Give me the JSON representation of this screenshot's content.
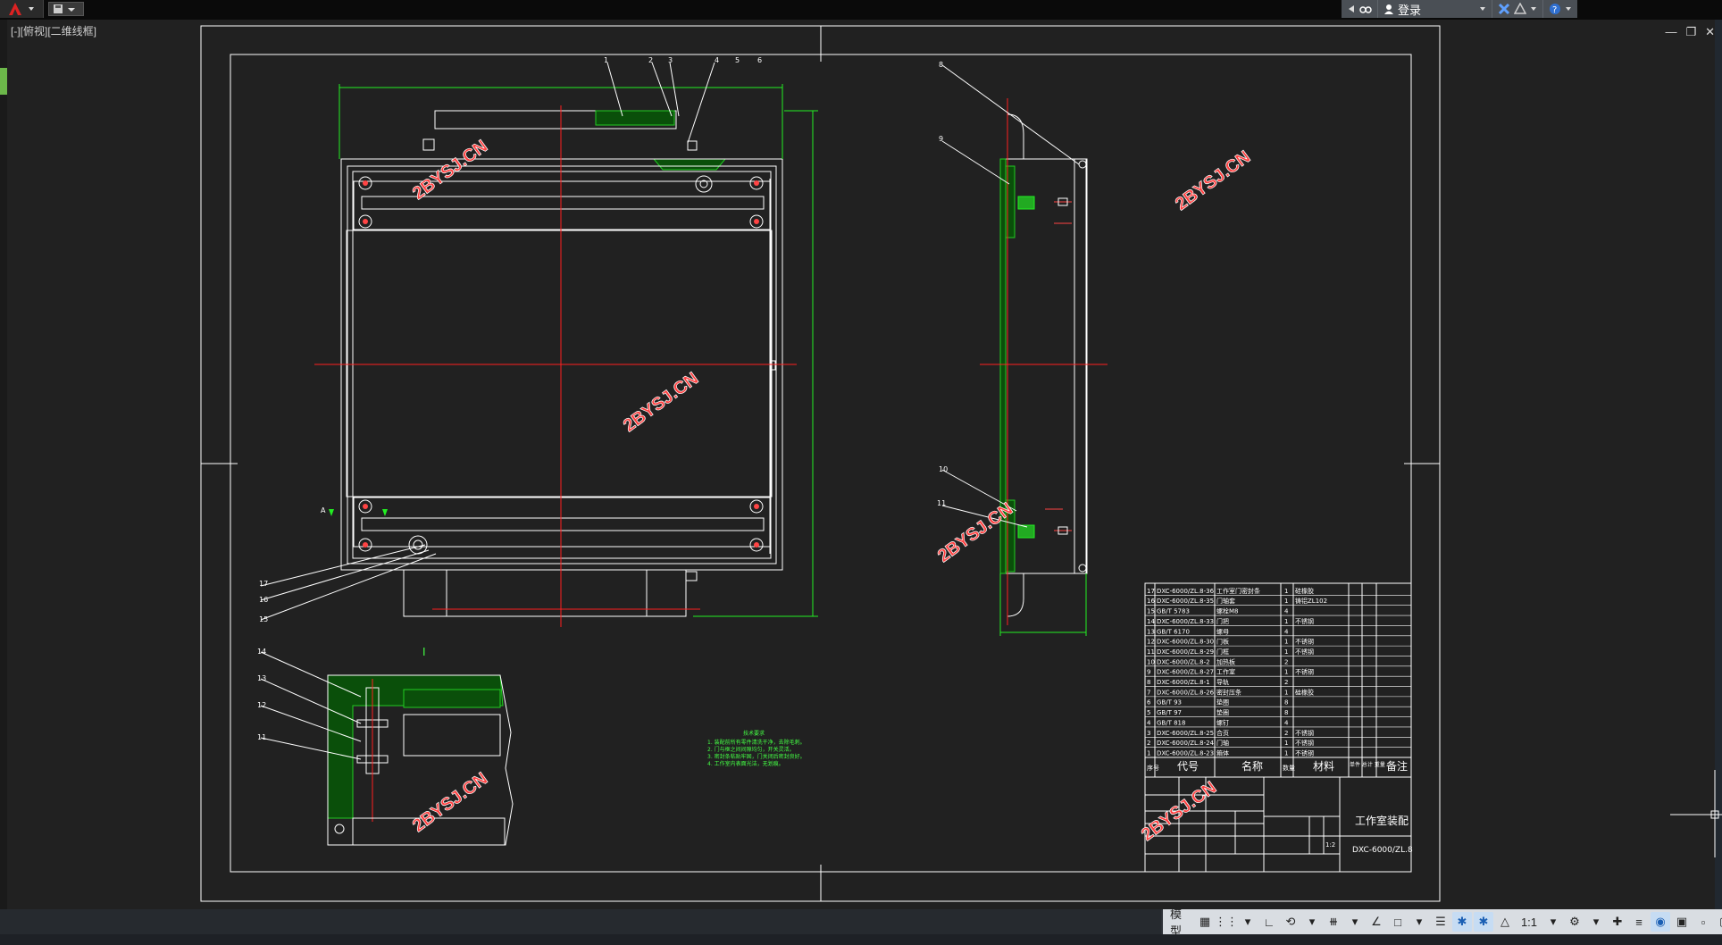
{
  "titlebar": {
    "signin_label": "登录"
  },
  "viewport": {
    "label": "[-][俯视][二维线框]"
  },
  "drawing": {
    "watermark": "2BYSJ.CN",
    "title_block": {
      "drawing_name": "工作室装配",
      "drawing_number": "DXC-6000/ZL.8",
      "scale": "1:2",
      "header_no": "序号",
      "header_code": "代号",
      "header_name": "名称",
      "header_qty": "数量",
      "header_material": "材料",
      "header_weight": "单件 总计 重量",
      "header_note": "备注"
    },
    "parts_list": [
      {
        "no": "17",
        "code": "DXC-6000/ZL.8-36",
        "name": "工作室门密封条",
        "qty": "1",
        "material": "硅橡胶"
      },
      {
        "no": "16",
        "code": "DXC-6000/ZL.8-35",
        "name": "门轴套",
        "qty": "1",
        "material": "铸铝ZL102"
      },
      {
        "no": "15",
        "code": "GB/T 5783",
        "name": "螺栓M8",
        "qty": "4",
        "material": ""
      },
      {
        "no": "14",
        "code": "DXC-6000/ZL.8-33",
        "name": "门把",
        "qty": "1",
        "material": "不锈钢"
      },
      {
        "no": "13",
        "code": "GB/T 6170",
        "name": "螺母",
        "qty": "4",
        "material": ""
      },
      {
        "no": "12",
        "code": "DXC-6000/ZL.8-30",
        "name": "门板",
        "qty": "1",
        "material": "不锈钢"
      },
      {
        "no": "11",
        "code": "DXC-6000/ZL.8-29",
        "name": "门框",
        "qty": "1",
        "material": "不锈钢"
      },
      {
        "no": "10",
        "code": "DXC-6000/ZL.8-2",
        "name": "加热板",
        "qty": "2",
        "material": ""
      },
      {
        "no": "9",
        "code": "DXC-6000/ZL.8-27",
        "name": "工作室",
        "qty": "1",
        "material": "不锈钢"
      },
      {
        "no": "8",
        "code": "DXC-6000/ZL.8-1",
        "name": "导轨",
        "qty": "2",
        "material": ""
      },
      {
        "no": "7",
        "code": "DXC-6000/ZL.8-26",
        "name": "密封压条",
        "qty": "1",
        "material": "硅橡胶"
      },
      {
        "no": "6",
        "code": "GB/T 93",
        "name": "垫圈",
        "qty": "8",
        "material": ""
      },
      {
        "no": "5",
        "code": "GB/T 97",
        "name": "垫圈",
        "qty": "8",
        "material": ""
      },
      {
        "no": "4",
        "code": "GB/T 818",
        "name": "螺钉",
        "qty": "4",
        "material": ""
      },
      {
        "no": "3",
        "code": "DXC-6000/ZL.8-25",
        "name": "合页",
        "qty": "2",
        "material": "不锈钢"
      },
      {
        "no": "2",
        "code": "DXC-6000/ZL.8-24",
        "name": "门轴",
        "qty": "1",
        "material": "不锈钢"
      },
      {
        "no": "1",
        "code": "DXC-6000/ZL.8-23",
        "name": "箱体",
        "qty": "1",
        "material": "不锈钢"
      }
    ],
    "tech_title": "技术要求",
    "tech_notes": [
      "1. 装配前所有零件清洗干净，去除毛刺。",
      "2. 门与框之间间隙均匀，开关灵活。",
      "3. 密封条粘贴牢固，门关闭后密封良好。",
      "4. 工作室内表面光洁，无划痕。"
    ],
    "balloons_top": [
      "1",
      "2",
      "3",
      "4",
      "5",
      "6"
    ],
    "balloons_side": [
      "8",
      "9",
      "10",
      "11"
    ],
    "balloons_left": [
      "17",
      "16",
      "15"
    ],
    "balloons_detail": [
      "14",
      "13",
      "12",
      "11"
    ],
    "section_label": "A",
    "detail_label": "I"
  },
  "statusbar": {
    "model_tab": "模型",
    "scale": "1:1"
  },
  "colors": {
    "bg": "#212121",
    "line": "#ffffff",
    "centerline": "#ff2020",
    "dimension": "#22ee22",
    "hatch": "#22cc22"
  }
}
